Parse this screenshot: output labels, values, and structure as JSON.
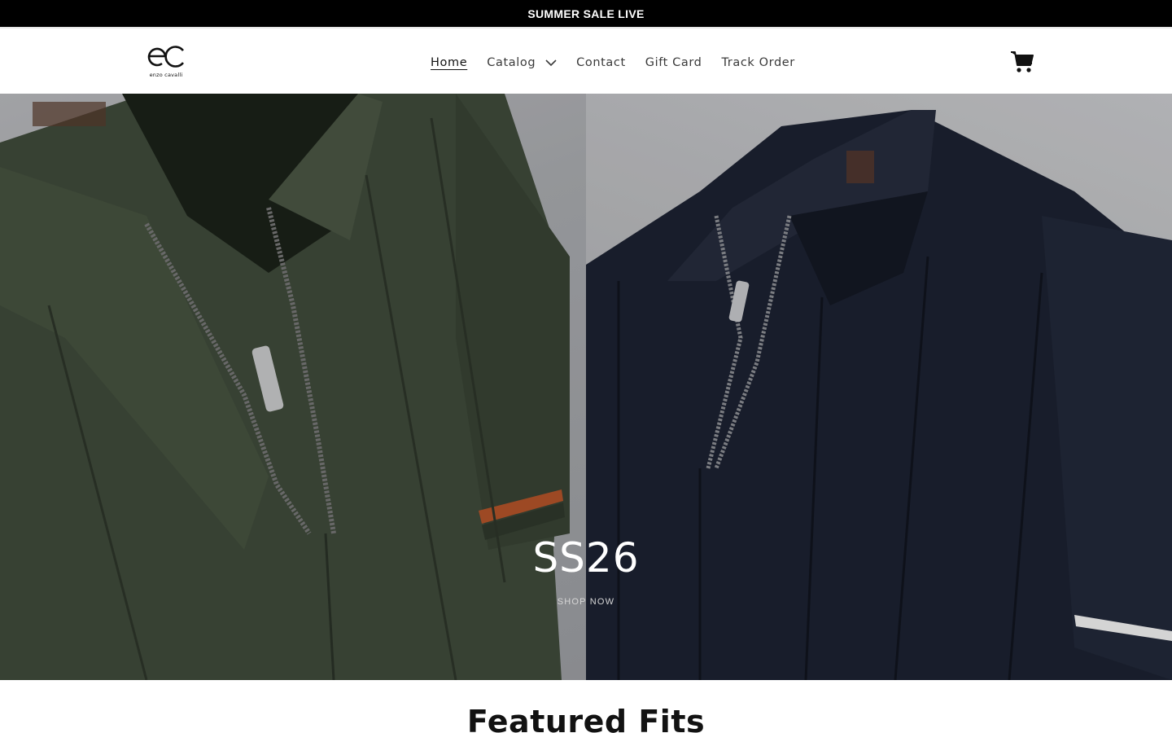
{
  "announcement": {
    "text": "SUMMER SALE LIVE"
  },
  "brand": {
    "monogram": "ec",
    "name": "enzo cavalli"
  },
  "nav": {
    "items": [
      {
        "label": "Home",
        "active": true
      },
      {
        "label": "Catalog",
        "has_dropdown": true
      },
      {
        "label": "Contact"
      },
      {
        "label": "Gift Card"
      },
      {
        "label": "Track Order"
      }
    ]
  },
  "header": {
    "cart_icon": "cart-icon"
  },
  "hero": {
    "title": "SS26",
    "cta": "SHOP NOW",
    "left_image": "green knit zip polo shirt",
    "right_image": "navy knit zip polo shirt"
  },
  "featured": {
    "title": "Featured Fits"
  },
  "colors": {
    "announcement_bg": "#000000",
    "green_shirt": "#3f4a3b",
    "navy_shirt": "#1c2231",
    "accent_stripe": "#b3542a"
  }
}
